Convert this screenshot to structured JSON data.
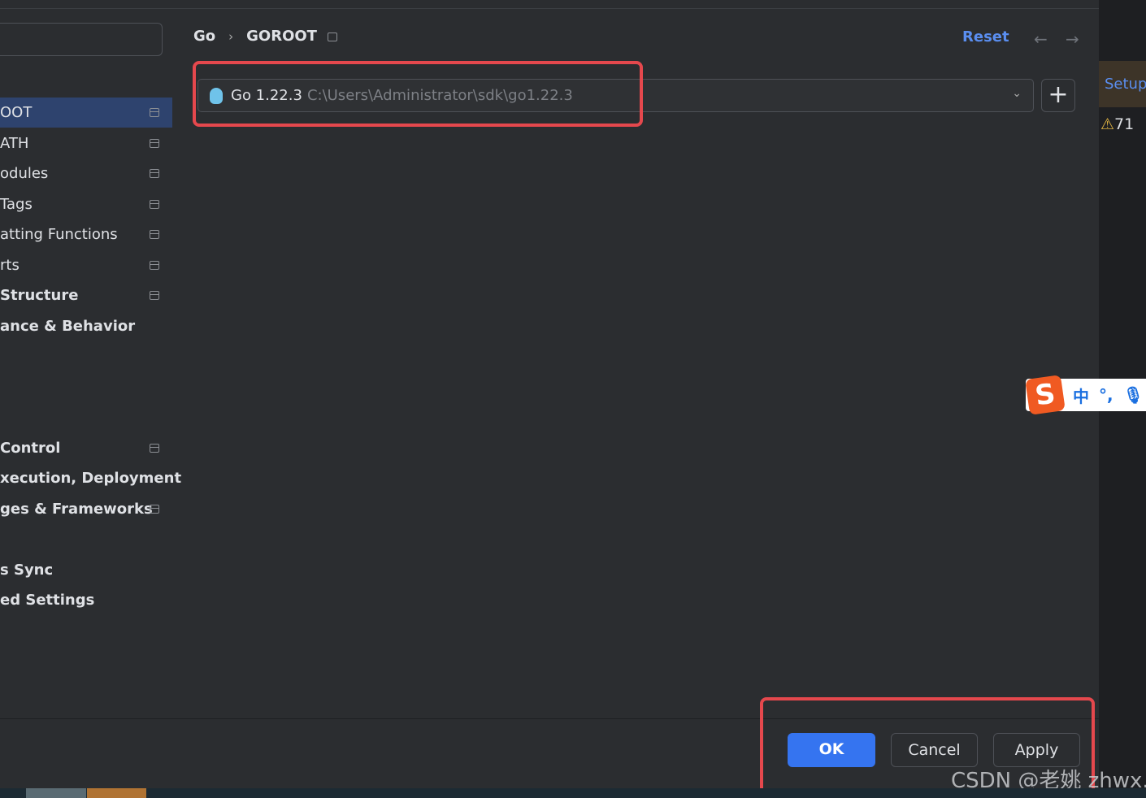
{
  "sidebar": {
    "items": [
      {
        "label": "OOT",
        "selected": true,
        "pinned": true,
        "bold": false
      },
      {
        "label": "ATH",
        "pinned": true,
        "bold": false
      },
      {
        "label": "odules",
        "pinned": true,
        "bold": false
      },
      {
        "label": " Tags",
        "pinned": true,
        "bold": false
      },
      {
        "label": "atting Functions",
        "pinned": true,
        "bold": false
      },
      {
        "label": "rts",
        "pinned": true,
        "bold": false
      },
      {
        "label": "Structure",
        "pinned": true,
        "bold": true
      },
      {
        "label": "ance & Behavior",
        "pinned": false,
        "bold": true
      },
      {
        "label": "",
        "pinned": false,
        "bold": true
      },
      {
        "label": " Control",
        "pinned": true,
        "bold": true
      },
      {
        "label": "xecution, Deployment",
        "pinned": false,
        "bold": true
      },
      {
        "label": "ges & Frameworks",
        "pinned": true,
        "bold": true
      },
      {
        "label": "s Sync",
        "pinned": false,
        "bold": true
      },
      {
        "label": "ed Settings",
        "pinned": false,
        "bold": true
      }
    ]
  },
  "breadcrumb": {
    "parent": "Go",
    "separator": "›",
    "current": "GOROOT"
  },
  "header": {
    "reset": "Reset",
    "back_icon": "arrow-left",
    "forward_icon": "arrow-right"
  },
  "sdk": {
    "name": "Go 1.22.3",
    "path": "C:\\Users\\Administrator\\sdk\\go1.22.3",
    "add": "+"
  },
  "right_panel": {
    "setup": "Setup",
    "warnings": "71"
  },
  "buttons": {
    "ok": "OK",
    "cancel": "Cancel",
    "apply": "Apply"
  },
  "ime": {
    "logo": "S",
    "mode": "中",
    "punct": "°,"
  },
  "watermark": "CSDN @老姚 zhwx.cn",
  "colors": {
    "accent": "#3574f0",
    "highlight": "#e5484d",
    "link": "#5a8ef0"
  }
}
